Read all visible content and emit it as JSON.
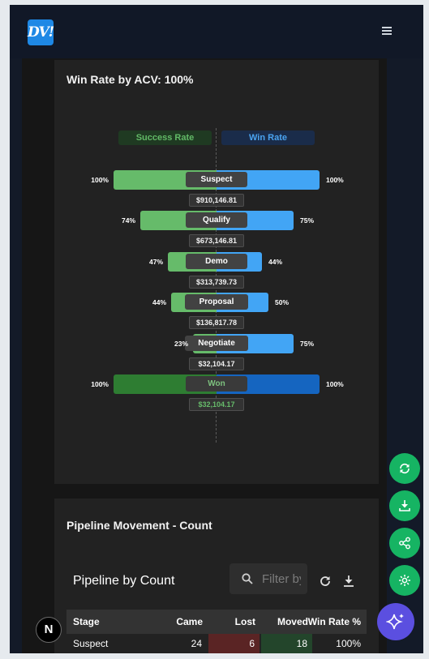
{
  "header": {
    "logo_text": "DV!"
  },
  "win_rate_card": {
    "title": "Win Rate by ACV: 100%"
  },
  "chart_data": {
    "type": "bar",
    "legend": [
      "Success Rate",
      "Win Rate"
    ],
    "categories": [
      "Suspect",
      "Qualify",
      "Demo",
      "Proposal",
      "Negotiate",
      "Won"
    ],
    "series": [
      {
        "name": "Success Rate",
        "values": [
          100,
          74,
          47,
          44,
          23,
          100
        ]
      },
      {
        "name": "Win Rate",
        "values": [
          100,
          75,
          44,
          50,
          75,
          100
        ]
      }
    ],
    "labels": {
      "success": [
        "100%",
        "74%",
        "47%",
        "44%",
        "23%",
        "100%"
      ],
      "win": [
        "100%",
        "75%",
        "44%",
        "50%",
        "75%",
        "100%"
      ]
    },
    "acv": [
      "$910,146.81",
      "$673,146.81",
      "$313,739.73",
      "$136,817.78",
      "$32,104.17",
      "$32,104.17"
    ]
  },
  "pipeline_card": {
    "title": "Pipeline Movement - Count",
    "table_title": "Pipeline by Count",
    "filter_placeholder": "Filter by",
    "columns": [
      "Stage",
      "Came",
      "Lost",
      "Moved",
      "Win Rate %"
    ],
    "rows": [
      {
        "stage": "Suspect",
        "came": "24",
        "lost": "6",
        "moved": "18",
        "win_rate": "100%"
      }
    ]
  },
  "colors": {
    "success": "#66bb6a",
    "win": "#42a5f5",
    "fab": "#16b463",
    "ai_fab": "#5b4fe0"
  },
  "icons": [
    "menu-icon",
    "refresh-icon",
    "download-icon",
    "share-icon",
    "settings-icon",
    "sparkle-icon",
    "search-icon"
  ],
  "badge": {
    "text": "N"
  }
}
